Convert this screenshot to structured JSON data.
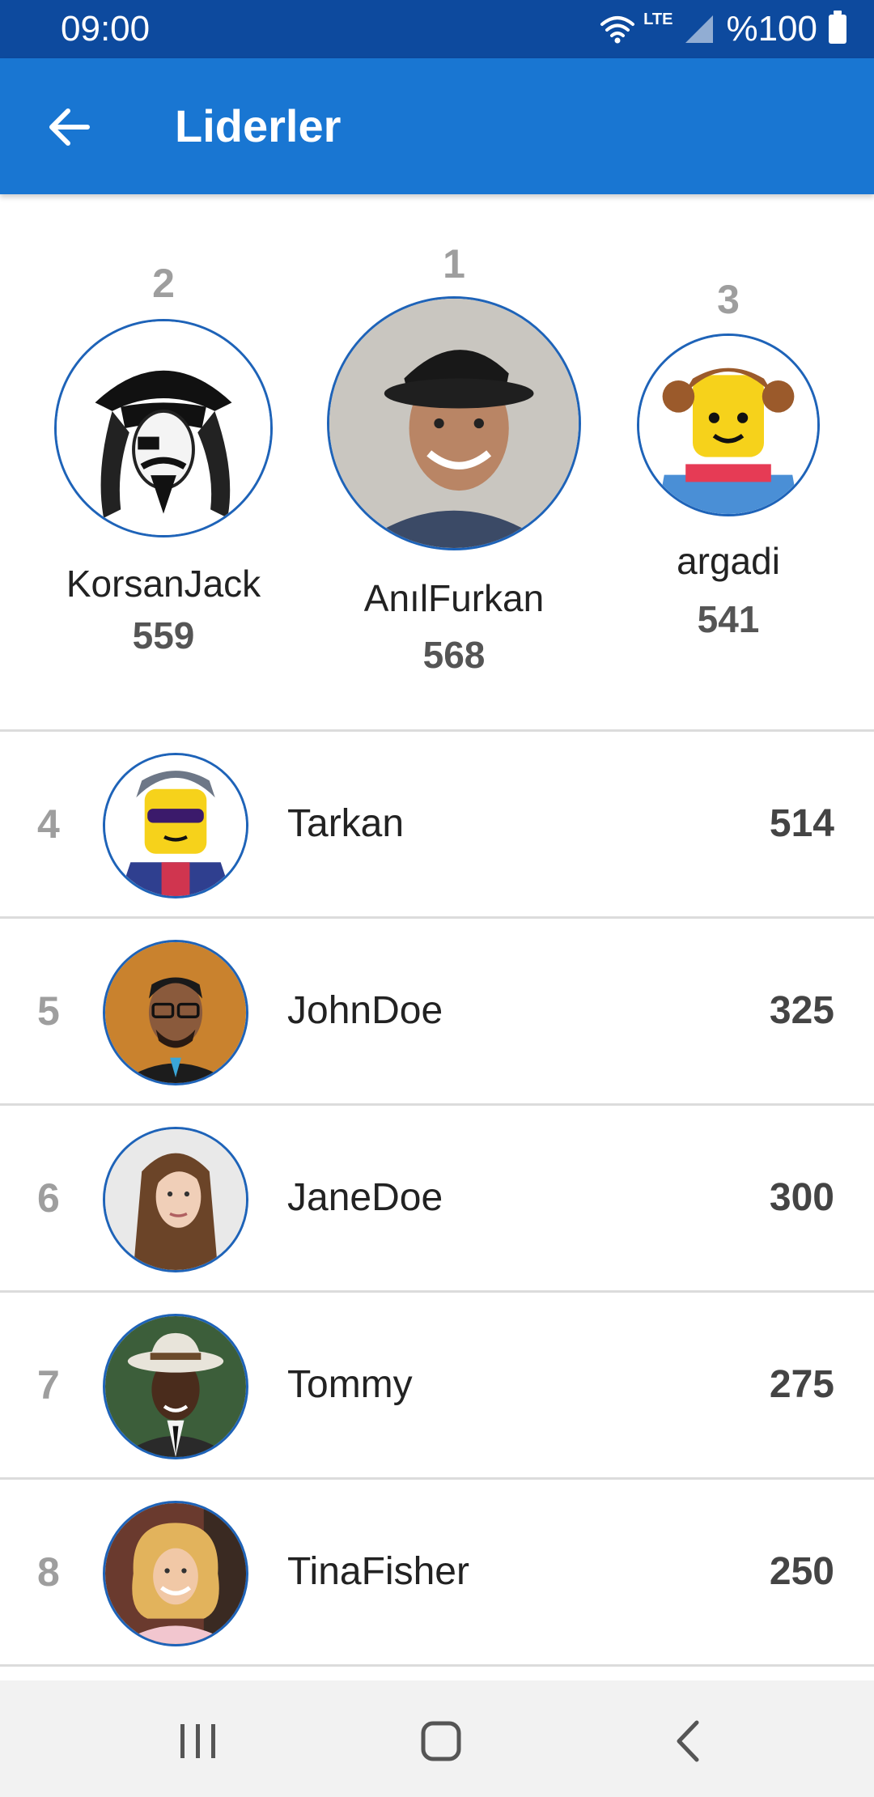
{
  "status_bar": {
    "time": "09:00",
    "network": "LTE",
    "battery": "%100",
    "icons": [
      "wifi-icon",
      "signal-icon",
      "battery-icon"
    ]
  },
  "app_bar": {
    "title": "Liderler",
    "back_icon": "arrow-back-icon",
    "color": "#1976d2"
  },
  "podium": [
    {
      "rank": "2",
      "name": "KorsanJack",
      "score": "559",
      "avatar": "pirate-avatar"
    },
    {
      "rank": "1",
      "name": "AnılFurkan",
      "score": "568",
      "avatar": "man-in-hat-avatar"
    },
    {
      "rank": "3",
      "name": "argadi",
      "score": "541",
      "avatar": "lego-girl-avatar"
    }
  ],
  "leaderboard": [
    {
      "rank": "4",
      "name": "Tarkan",
      "score": "514",
      "avatar": "lego-sunglasses-avatar"
    },
    {
      "rank": "5",
      "name": "JohnDoe",
      "score": "325",
      "avatar": "man-glasses-avatar"
    },
    {
      "rank": "6",
      "name": "JaneDoe",
      "score": "300",
      "avatar": "woman-avatar"
    },
    {
      "rank": "7",
      "name": "Tommy",
      "score": "275",
      "avatar": "man-white-hat-avatar"
    },
    {
      "rank": "8",
      "name": "TinaFisher",
      "score": "250",
      "avatar": "blonde-woman-avatar"
    }
  ],
  "nav_bar": {
    "buttons": [
      "recent-apps-icon",
      "home-icon",
      "back-icon"
    ]
  },
  "colors": {
    "status_bar": "#0d4a9e",
    "accent": "#1976d2",
    "avatar_border": "#1e63b8",
    "rank_gray": "#9e9e9e"
  }
}
